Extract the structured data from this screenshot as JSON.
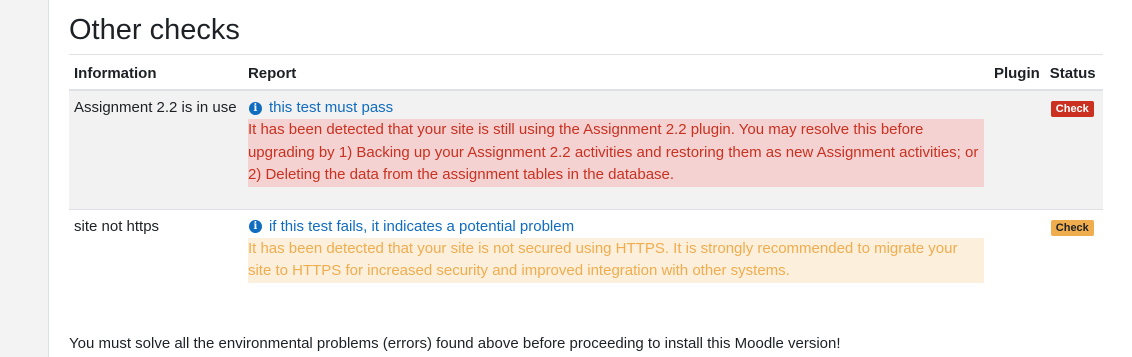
{
  "section": {
    "title": "Other checks"
  },
  "table": {
    "headers": {
      "information": "Information",
      "report": "Report",
      "plugin": "Plugin",
      "status": "Status"
    },
    "rows": [
      {
        "information": "Assignment 2.2 is in use",
        "report_link": "this test must pass",
        "report_link_icon": "info-icon",
        "message": "It has been detected that your site is still using the Assignment 2.2 plugin. You may resolve this before upgrading by 1) Backing up your Assignment 2.2 activities and restoring them as new Assignment activities; or 2) Deleting the data from the assignment tables in the database.",
        "plugin": "",
        "status": "Check",
        "status_color": "#ca3120",
        "message_bg": "#f4d2d2",
        "message_color": "#ca3120"
      },
      {
        "information": "site not https",
        "report_link": "if this test fails, it indicates a potential problem",
        "report_link_icon": "info-icon",
        "message": "It has been detected that your site is not secured using HTTPS. It is strongly recommended to migrate your site to HTTPS for increased security and improved integration with other systems.",
        "plugin": "",
        "status": "Check",
        "status_color": "#f0ad4e",
        "message_bg": "#fcefdc",
        "message_color": "#f0ad4e"
      }
    ]
  },
  "footer": {
    "message": "You must solve all the environmental problems (errors) found above before proceeding to install this Moodle version!"
  },
  "colors": {
    "link": "#0f6cbf",
    "page_bg": "#f3f3f3",
    "card_bg": "#ffffff"
  }
}
